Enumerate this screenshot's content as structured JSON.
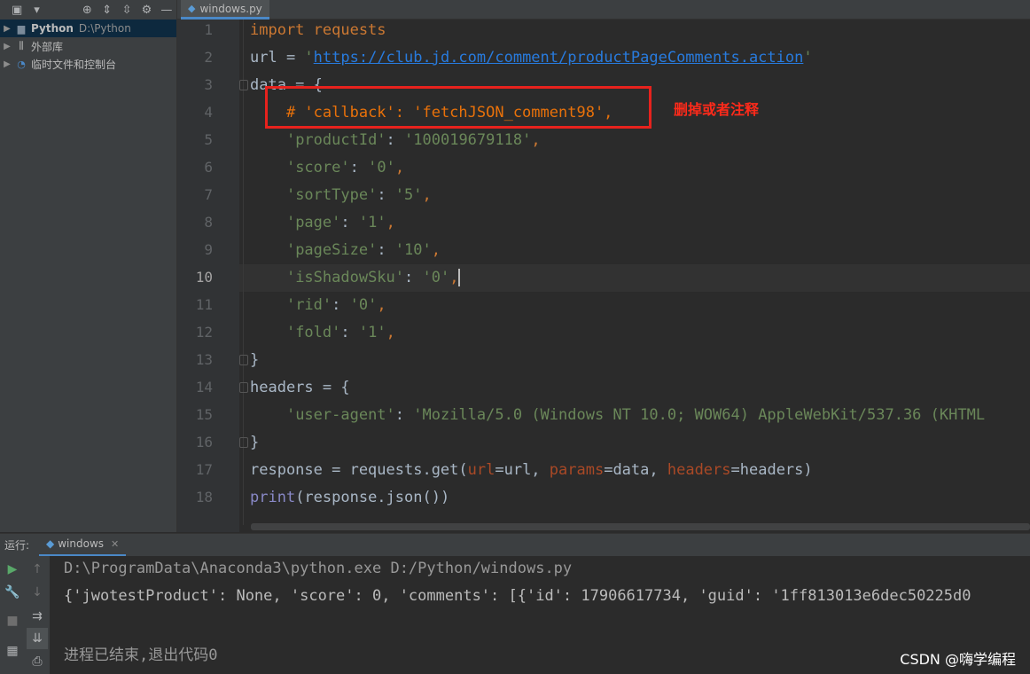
{
  "project_panel": {
    "root": {
      "label": "Python",
      "path": "D:\\Python"
    },
    "items": [
      {
        "label": "外部库"
      },
      {
        "label": "临时文件和控制台"
      }
    ]
  },
  "editor": {
    "tab_label": "windows.py",
    "current_line": 10,
    "line_numbers": [
      "1",
      "2",
      "3",
      "4",
      "5",
      "6",
      "7",
      "8",
      "9",
      "10",
      "11",
      "12",
      "13",
      "14",
      "15",
      "16",
      "17",
      "18"
    ],
    "lines": [
      [
        {
          "t": "import requests",
          "c": "kw"
        }
      ],
      [
        {
          "t": "url = "
        },
        {
          "t": "'",
          "c": "str"
        },
        {
          "t": "https://club.jd.com/comment/productPageComments.action",
          "c": "url"
        },
        {
          "t": "'",
          "c": "str"
        }
      ],
      [
        {
          "t": "data = {"
        }
      ],
      [
        {
          "t": "    "
        },
        {
          "t": "# 'callback': 'fetchJSON_comment98',",
          "c": "cmt"
        }
      ],
      [
        {
          "t": "    "
        },
        {
          "t": "'productId'",
          "c": "str"
        },
        {
          "t": ": "
        },
        {
          "t": "'100019679118'",
          "c": "str"
        },
        {
          "t": ",",
          "c": "kw"
        }
      ],
      [
        {
          "t": "    "
        },
        {
          "t": "'score'",
          "c": "str"
        },
        {
          "t": ": "
        },
        {
          "t": "'0'",
          "c": "str"
        },
        {
          "t": ",",
          "c": "kw"
        }
      ],
      [
        {
          "t": "    "
        },
        {
          "t": "'sortType'",
          "c": "str"
        },
        {
          "t": ": "
        },
        {
          "t": "'5'",
          "c": "str"
        },
        {
          "t": ",",
          "c": "kw"
        }
      ],
      [
        {
          "t": "    "
        },
        {
          "t": "'page'",
          "c": "str"
        },
        {
          "t": ": "
        },
        {
          "t": "'1'",
          "c": "str"
        },
        {
          "t": ",",
          "c": "kw"
        }
      ],
      [
        {
          "t": "    "
        },
        {
          "t": "'pageSize'",
          "c": "str"
        },
        {
          "t": ": "
        },
        {
          "t": "'10'",
          "c": "str"
        },
        {
          "t": ",",
          "c": "kw"
        }
      ],
      [
        {
          "t": "    "
        },
        {
          "t": "'isShadowSku'",
          "c": "str"
        },
        {
          "t": ": "
        },
        {
          "t": "'0'",
          "c": "str"
        },
        {
          "t": ",",
          "c": "kw"
        }
      ],
      [
        {
          "t": "    "
        },
        {
          "t": "'rid'",
          "c": "str"
        },
        {
          "t": ": "
        },
        {
          "t": "'0'",
          "c": "str"
        },
        {
          "t": ",",
          "c": "kw"
        }
      ],
      [
        {
          "t": "    "
        },
        {
          "t": "'fold'",
          "c": "str"
        },
        {
          "t": ": "
        },
        {
          "t": "'1'",
          "c": "str"
        },
        {
          "t": ",",
          "c": "kw"
        }
      ],
      [
        {
          "t": "}"
        }
      ],
      [
        {
          "t": "headers = {"
        }
      ],
      [
        {
          "t": "    "
        },
        {
          "t": "'user-agent'",
          "c": "str"
        },
        {
          "t": ": "
        },
        {
          "t": "'Mozilla/5.0 (Windows NT 10.0; WOW64) AppleWebKit/537.36 (KHTML",
          "c": "str"
        }
      ],
      [
        {
          "t": "}"
        }
      ],
      [
        {
          "t": "response = requests.get("
        },
        {
          "t": "url",
          "c": "prm"
        },
        {
          "t": "=url, "
        },
        {
          "t": "params",
          "c": "prm"
        },
        {
          "t": "=data, "
        },
        {
          "t": "headers",
          "c": "prm"
        },
        {
          "t": "=headers)"
        }
      ],
      [
        {
          "t": "print",
          "c": "fn"
        },
        {
          "t": "(response.json())"
        }
      ]
    ],
    "annotation": "删掉或者注释"
  },
  "run_panel": {
    "title": "运行:",
    "tab_label": "windows",
    "console": [
      "D:\\ProgramData\\Anaconda3\\python.exe D:/Python/windows.py",
      "{'jwotestProduct': None, 'score': 0, 'comments': [{'id': 17906617734, 'guid': '1ff813013e6dec50225d0",
      "",
      "进程已结束,退出代码0"
    ]
  },
  "watermark": "CSDN @嗨学编程"
}
